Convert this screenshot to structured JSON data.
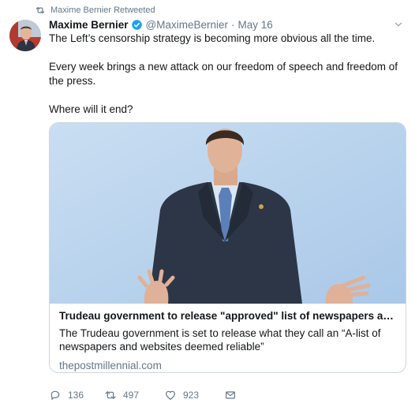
{
  "retweet_line": {
    "text": "Maxime Bernier Retweeted"
  },
  "tweet": {
    "author_name": "Maxime Bernier",
    "handle": "@MaximeBernier",
    "separator": "·",
    "date": "May 16",
    "paragraphs": [
      "The Left’s censorship strategy is becoming more obvious all the time.",
      "Every week brings a new attack on our freedom of speech and freedom of the press.",
      "Where will it end?"
    ]
  },
  "card": {
    "title": "Trudeau government to release \"approved\" list of newspapers and w...",
    "description": "The Trudeau government is set to release what they call an “A-list of newspapers and websites deemed reliable”",
    "domain": "thepostmillennial.com"
  },
  "actions": {
    "reply_count": "136",
    "retweet_count": "497",
    "like_count": "923"
  },
  "icons": {
    "retweet": "retweet-icon",
    "verified": "verified-badge-icon",
    "reply": "reply-icon",
    "like": "heart-icon",
    "message": "direct-message-icon",
    "caret": "chevron-down-icon"
  },
  "colors": {
    "text": "#14171a",
    "muted": "#657786",
    "verified": "#1da1f2",
    "border": "#ccd6dd",
    "sky": "#b9d6f0"
  }
}
